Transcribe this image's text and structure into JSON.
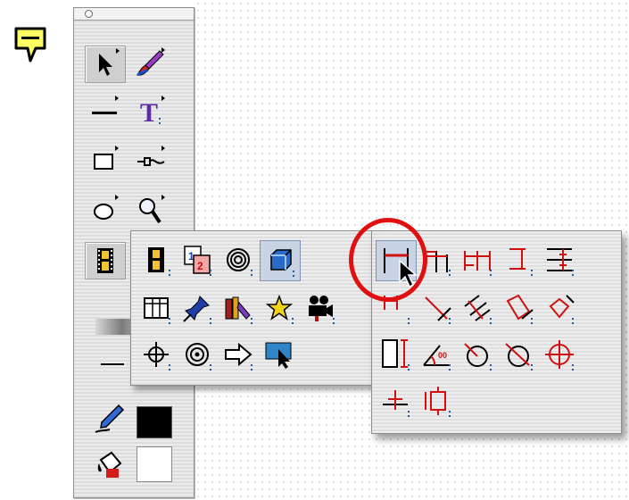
{
  "palette": {
    "title_icon": "close-box-icon",
    "tools": [
      {
        "name": "arrow-tool",
        "icon": "arrow-pointer-icon",
        "selected": true
      },
      {
        "name": "brush-tool",
        "icon": "paintbrush-icon"
      },
      {
        "name": "line-tool",
        "icon": "line-icon"
      },
      {
        "name": "text-tool",
        "icon": "text-T-icon"
      },
      {
        "name": "rectangle-tool",
        "icon": "rectangle-icon"
      },
      {
        "name": "connector-tool",
        "icon": "connector-icon"
      },
      {
        "name": "oval-tool",
        "icon": "oval-icon"
      },
      {
        "name": "zoom-tool",
        "icon": "magnifier-icon"
      },
      {
        "name": "film-tool",
        "icon": "film-strip-icon"
      },
      {
        "name": "gradient-fill",
        "icon": "gradient-icon"
      },
      {
        "name": "line-weight",
        "icon": "line-weight-icon"
      },
      {
        "name": "pen-color",
        "icon": "pen-icon",
        "color": "#000000"
      },
      {
        "name": "fill-color",
        "icon": "paint-bucket-icon",
        "color": "#ffffff"
      }
    ]
  },
  "popup1": {
    "tools": [
      "film-icon",
      "page-number-icon",
      "spiral-icon",
      "3d-box-icon",
      "table-icon",
      "pushpin-icon",
      "books-icon",
      "star-icon",
      "movie-camera-icon",
      "crosshair-icon",
      "spiral-arrow-icon",
      "arrow-shape-icon",
      "screen-pointer-icon"
    ]
  },
  "popup2": {
    "tools": [
      "horizontal-dimension-icon",
      "baseline-dimension-icon",
      "chain-dimension-icon",
      "vertical-dimension-icon",
      "stacked-dimension-icon",
      "ordinate-dimension-icon",
      "aligned-dimension-icon",
      "angular-dimension-icon",
      "rotated-dimension-icon",
      "height-dimension-icon",
      "angle-dimension-icon",
      "radius-dimension-icon",
      "diameter-dimension-icon",
      "center-mark-icon",
      "datum-icon",
      "frame-dimension-icon"
    ],
    "selected": "horizontal-dimension-icon"
  },
  "colors": {
    "accent_red": "#e01010",
    "balloon_yellow": "#ffff66"
  }
}
